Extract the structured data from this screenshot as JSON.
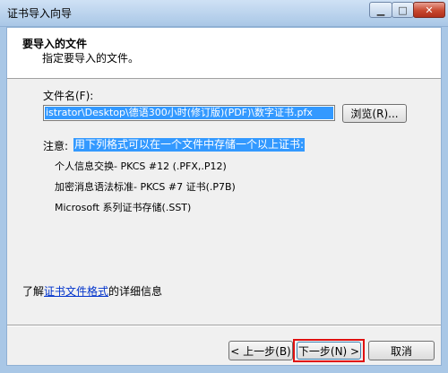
{
  "window": {
    "title": "证书导入向导",
    "min_symbol": "▁",
    "max_symbol": "□",
    "close_symbol": "✕"
  },
  "header": {
    "title": "要导入的文件",
    "subtitle": "指定要导入的文件。"
  },
  "file": {
    "label": "文件名(F):",
    "value": "istrator\\Desktop\\德语300小时(修订版)(PDF)\\数字证书.pfx",
    "browse_label": "浏览(R)..."
  },
  "note": {
    "prefix": "注意:",
    "text": "用下列格式可以在一个文件中存储一个以上证书:"
  },
  "formats": [
    "个人信息交换- PKCS #12 (.PFX,.P12)",
    "加密消息语法标准- PKCS #7 证书(.P7B)",
    "Microsoft 系列证书存储(.SST)"
  ],
  "learn_more": {
    "prefix": "了解",
    "link": "证书文件格式",
    "suffix": "的详细信息"
  },
  "buttons": {
    "back": "< 上一步(B)",
    "next": "下一步(N) >",
    "cancel": "取消"
  }
}
